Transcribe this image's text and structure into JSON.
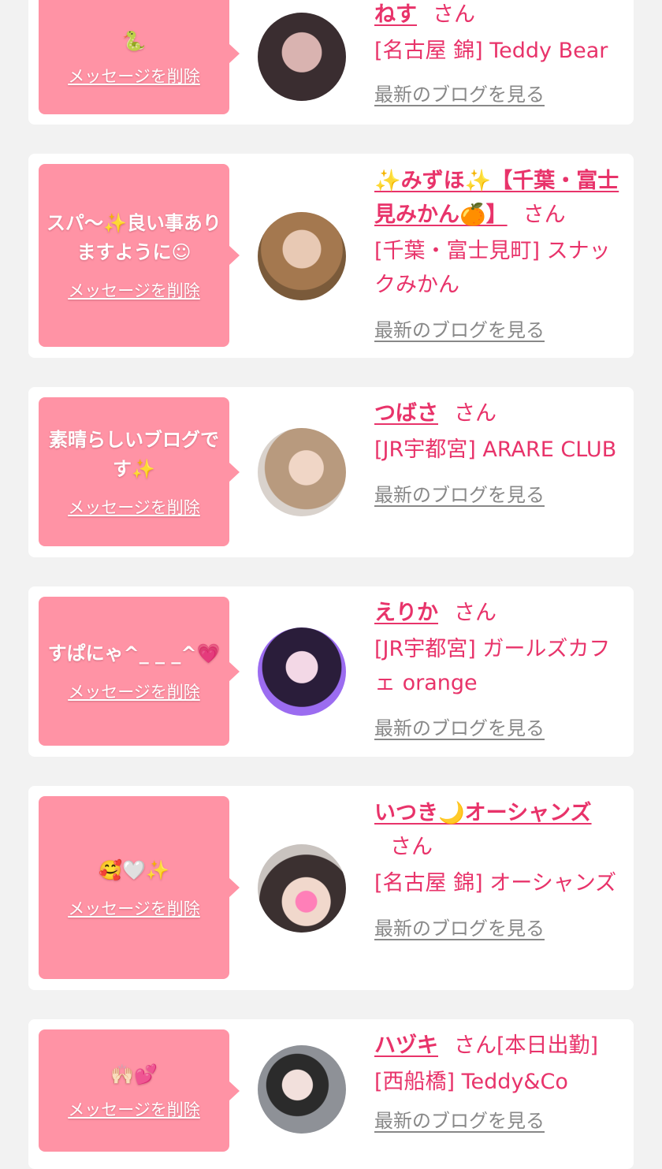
{
  "colors": {
    "accent": "#e8336a",
    "bubble": "#ff93a5",
    "link_gray": "#888888",
    "background": "#f2f2f2"
  },
  "delete_label": "メッセージを削除",
  "blog_label": "最新のブログを見る",
  "san_label": "さん",
  "entries": [
    {
      "message": "🐍",
      "name": "ねす",
      "shop": "[名古屋 錦] Teddy Bear",
      "avatar_icon": "avatar-photo"
    },
    {
      "message": "スパ〜✨良い事ありますように☺︎",
      "name": "✨みずほ✨【千葉・富士見みかん🍊】",
      "shop": "[千葉・富士見町] スナックみかん",
      "avatar_icon": "avatar-photo"
    },
    {
      "message": "素晴らしいブログです✨",
      "name": "つばさ",
      "shop": "[JR宇都宮] ARARE CLUB",
      "avatar_icon": "avatar-photo"
    },
    {
      "message": "すぱにゃ^_ _ _^💗",
      "name": "えりか",
      "shop": "[JR宇都宮] ガールズカフェ orange",
      "avatar_icon": "avatar-photo"
    },
    {
      "message": "🥰🤍✨",
      "name": "いつき🌙オーシャンズ",
      "shop": "[名古屋 錦] オーシャンズ",
      "avatar_icon": "avatar-photo"
    },
    {
      "message": "🙌🏻💕",
      "name": "ハヅキ",
      "name_suffix": "[本日出勤]",
      "shop": "[西船橋] Teddy&Co",
      "avatar_icon": "avatar-photo"
    }
  ]
}
